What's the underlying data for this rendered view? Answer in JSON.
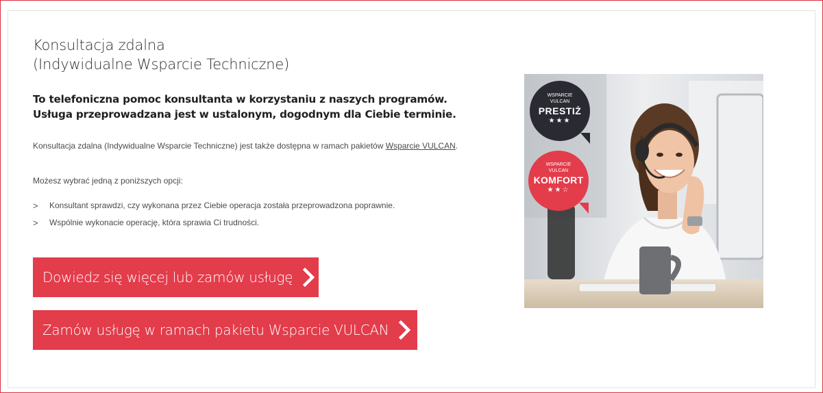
{
  "section": {
    "title_line1": "Konsultacja zdalna",
    "title_line2": "(Indywidualne Wsparcie Techniczne)",
    "lead_line1": "To telefoniczna pomoc konsultanta w korzystaniu z naszych programów.",
    "lead_line2": "Usługa przeprowadzana jest w ustalonym, dogodnym dla Ciebie terminie.",
    "para_text": "Konsultacja zdalna (Indywidualne Wsparcie Techniczne) jest także dostępna w ramach pakietów ",
    "para_link": "Wsparcie VULCAN",
    "para_end": ".",
    "options_label": "Możesz wybrać jedną z poniższych opcji:",
    "options": [
      "Konsultant sprawdzi, czy wykonana przez Ciebie operacja została przeprowadzona poprawnie.",
      "Wspólnie wykonacie operację, która sprawia Ci trudności."
    ],
    "bullet": ">",
    "btn_more": "Dowiedz się więcej lub zamów usługę",
    "btn_package": "Zamów usługę w ramach pakietu Wsparcie VULCAN"
  },
  "badges": {
    "prestiz": {
      "top": "WSPARCIE",
      "mid": "VULCAN",
      "name": "PRESTIŻ",
      "stars": "★★★"
    },
    "komfort": {
      "top": "WSPARCIE",
      "mid": "VULCAN",
      "name": "KOMFORT",
      "stars": "★★☆"
    }
  },
  "colors": {
    "accent": "#e33c4b",
    "frame": "#d9303f",
    "badge_dark": "#2a2a33",
    "badge_red": "#e33c4b"
  }
}
